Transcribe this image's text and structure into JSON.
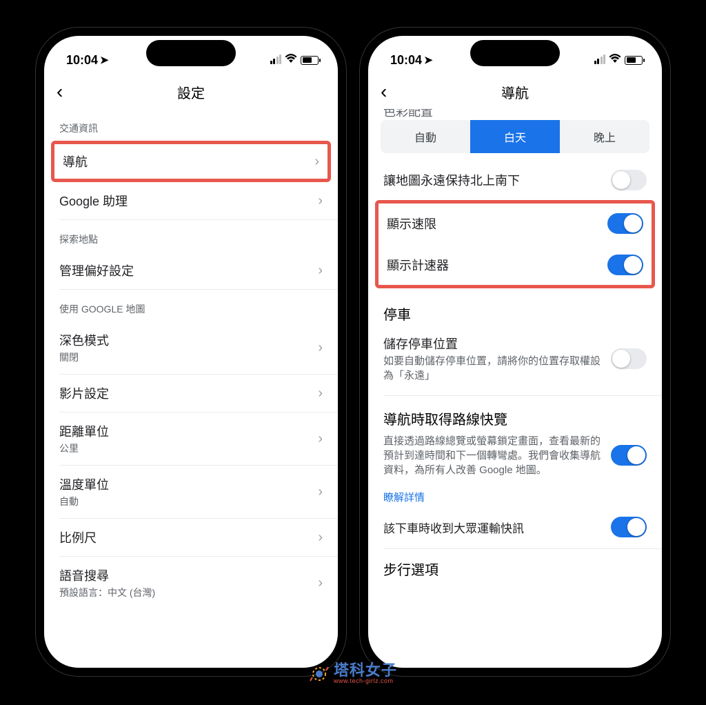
{
  "status": {
    "time": "10:04"
  },
  "phone1": {
    "title": "設定",
    "sections": {
      "traffic": {
        "header": "交通資訊",
        "nav": "導航",
        "assistant": "Google 助理"
      },
      "explore": {
        "header": "探索地點",
        "pref": "管理偏好設定"
      },
      "maps": {
        "header": "使用 GOOGLE 地圖",
        "dark": {
          "label": "深色模式",
          "value": "關閉"
        },
        "video": "影片設定",
        "distance": {
          "label": "距離單位",
          "value": "公里"
        },
        "temp": {
          "label": "溫度單位",
          "value": "自動"
        },
        "scale": "比例尺",
        "voice": {
          "label": "語音搜尋",
          "value": "預設語言：中文 (台灣)"
        }
      }
    }
  },
  "phone2": {
    "title": "導航",
    "colorSchemeCut": "色彩配置",
    "segments": {
      "auto": "自動",
      "day": "白天",
      "night": "晚上"
    },
    "northUp": "讓地圖永遠保持北上南下",
    "speedLimit": "顯示速限",
    "speedometer": "顯示計速器",
    "parking": {
      "header": "停車",
      "save": {
        "label": "儲存停車位置",
        "desc": "如要自動儲存停車位置，請將你的位置存取權設為「永遠」"
      }
    },
    "glance": {
      "header": "導航時取得路線快覽",
      "desc": "直接透過路線總覽或螢幕鎖定畫面，查看最新的預計到達時間和下一個轉彎處。我們會收集導航資料，為所有人改善 Google 地圖。",
      "link": "瞭解詳情"
    },
    "transit": "該下車時收到大眾運輸快訊",
    "walking": "步行選項"
  },
  "watermark": {
    "main": "塔科女子",
    "sub": "www.tech-girlz.com"
  }
}
